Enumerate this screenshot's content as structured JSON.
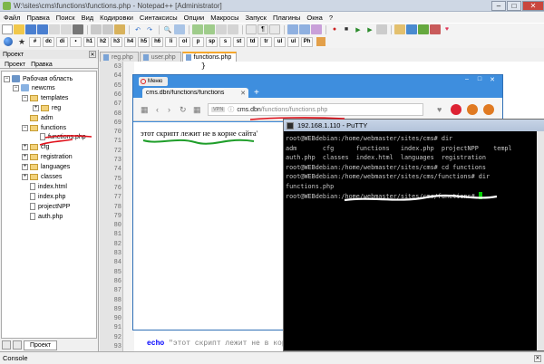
{
  "npp": {
    "title": "W:\\sites\\cms\\functions\\functions.php - Notepad++ [Administrator]",
    "window_controls": [
      "–",
      "□",
      "✕"
    ],
    "menu": [
      "Файл",
      "Правка",
      "Поиск",
      "Вид",
      "Кодировки",
      "Синтаксисы",
      "Опции",
      "Макросы",
      "Запуск",
      "Плагины",
      "Окна",
      "?"
    ],
    "tag_toolbar": [
      "#",
      "dc",
      "di",
      "•",
      "h1",
      "h2",
      "h3",
      "h4",
      "h5",
      "h6",
      "li",
      "ol",
      "p",
      "sp",
      "s",
      "st",
      "td",
      "tr",
      "ul",
      "ul",
      "Ph"
    ],
    "file_tabs": [
      "reg.php",
      "user.php",
      "functions.php"
    ],
    "active_tab": "functions.php",
    "status_label": "Console"
  },
  "panel": {
    "title": "Проект",
    "tabs": [
      "Проект",
      "Правка"
    ],
    "bottom_tab": "Проект",
    "tree": [
      {
        "label": "Рабочая область",
        "kind": "workspace",
        "level": 0
      },
      {
        "label": "newcms",
        "kind": "project",
        "level": 1
      },
      {
        "label": "templates",
        "kind": "folder",
        "level": 2
      },
      {
        "label": "reg",
        "kind": "folder",
        "level": 3
      },
      {
        "label": "adm",
        "kind": "folder",
        "level": 2
      },
      {
        "label": "functions",
        "kind": "folder",
        "level": 2
      },
      {
        "label": "functions.php",
        "kind": "file",
        "level": 3
      },
      {
        "label": "cfg",
        "kind": "folder",
        "level": 2
      },
      {
        "label": "registration",
        "kind": "folder",
        "level": 2
      },
      {
        "label": "languages",
        "kind": "folder",
        "level": 2
      },
      {
        "label": "classes",
        "kind": "folder",
        "level": 2
      },
      {
        "label": "index.html",
        "kind": "file",
        "level": 2
      },
      {
        "label": "index.php",
        "kind": "file",
        "level": 2
      },
      {
        "label": "projectNPP",
        "kind": "file",
        "level": 2
      },
      {
        "label": "auth.php",
        "kind": "file",
        "level": 2
      }
    ]
  },
  "editor": {
    "line_numbers": [
      "63",
      "64",
      "65",
      "66",
      "67",
      "68",
      "69",
      "70",
      "71",
      "72",
      "73",
      "74",
      "75",
      "76",
      "77",
      "78",
      "79",
      "80",
      "81",
      "82",
      "83",
      "84",
      "85",
      "86",
      "87",
      "88",
      "89",
      "90",
      "91",
      "92",
      "93"
    ],
    "top_line_text": "}",
    "code_keyword": "echo",
    "code_string": "\"этот скрипт лежит не в корне сайта'\""
  },
  "browser": {
    "menu_label": "Меню",
    "tab_title": "cms.dbn/functions/functions",
    "new_tab": "+",
    "controls": [
      "–",
      "□",
      "✕"
    ],
    "vpn_label": "VPN",
    "url_host": "cms.dbn",
    "url_path": "/functions/functions.php",
    "page_text": "этот скрипт лежит не в корне сайта'"
  },
  "putty": {
    "title": "192.168.1.110 - PuTTY",
    "lines": [
      "root@WEBdebian:/home/webmaster/sites/cms# dir",
      "adm       cfg      functions   index.php  projectNPP    templ",
      "auth.php  classes  index.html  languages  registration",
      "root@WEBdebian:/home/webmaster/sites/cms# cd functions",
      "root@WEBdebian:/home/webmaster/sites/cms/functions# dir",
      "functions.php"
    ],
    "prompt": "root@WEBdebian:/home/webmaster/sites/cms/functions# "
  },
  "colors": {
    "annotation_red": "#e0101a",
    "annotation_green": "#1f9e2a",
    "annotation_white": "#ffffff",
    "browser_frame": "#3e8ede"
  }
}
